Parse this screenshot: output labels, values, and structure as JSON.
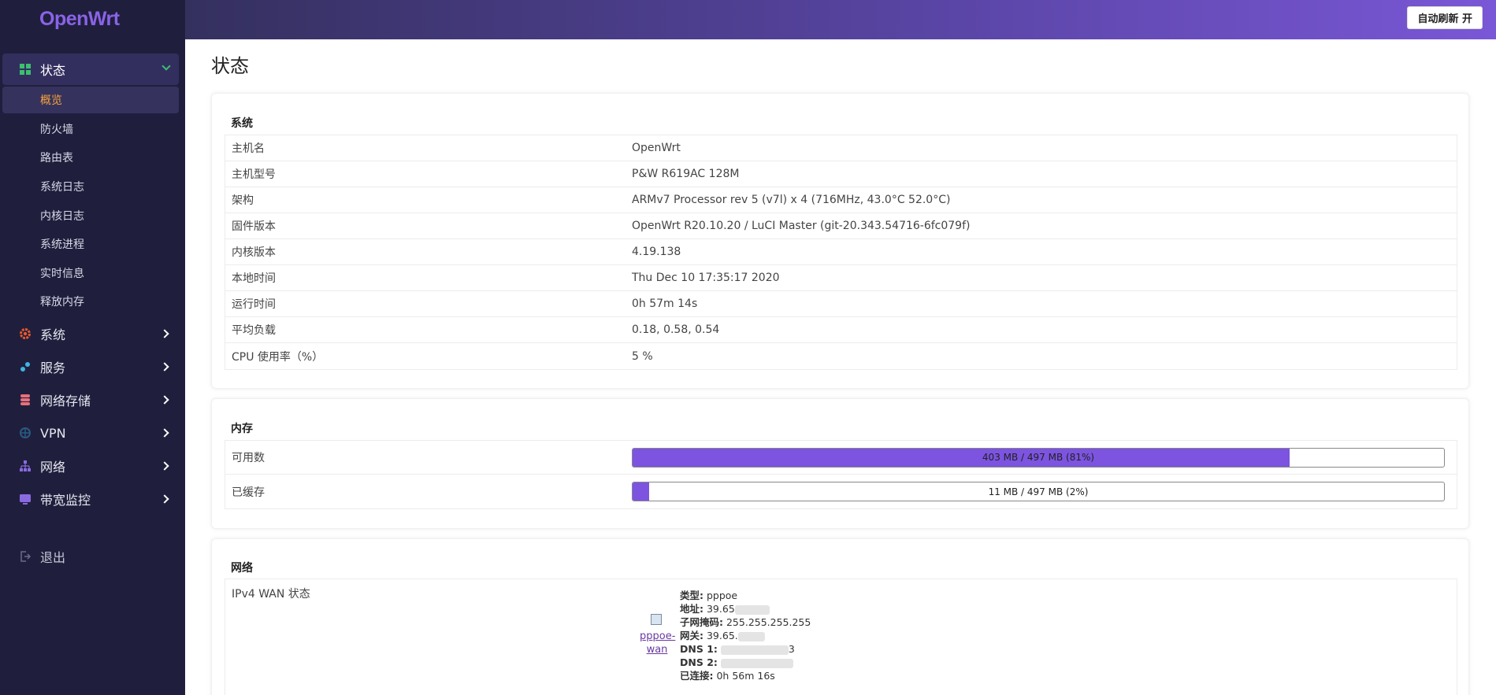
{
  "app": {
    "logo": "OpenWrt"
  },
  "header": {
    "auto_refresh_label": "自动刷新 开"
  },
  "sidebar": {
    "status_label": "状态",
    "sub_items": [
      "概览",
      "防火墙",
      "路由表",
      "系统日志",
      "内核日志",
      "系统进程",
      "实时信息",
      "释放内存"
    ],
    "items": [
      {
        "label": "系统",
        "icon": "gear-icon",
        "color": "#e8582a"
      },
      {
        "label": "服务",
        "icon": "services-icon",
        "color": "#3fb6e0"
      },
      {
        "label": "网络存储",
        "icon": "database-icon",
        "color": "#e8707a"
      },
      {
        "label": "VPN",
        "icon": "vpn-icon",
        "color": "#2a5a80"
      },
      {
        "label": "网络",
        "icon": "network-icon",
        "color": "#8a6ae0"
      },
      {
        "label": "带宽监控",
        "icon": "monitor-icon",
        "color": "#8a6ae0"
      }
    ],
    "logout_label": "退出"
  },
  "page": {
    "title": "状态"
  },
  "system": {
    "heading": "系统",
    "rows": [
      {
        "k": "主机名",
        "v": "OpenWrt"
      },
      {
        "k": "主机型号",
        "v": "P&W R619AC 128M"
      },
      {
        "k": "架构",
        "v": "ARMv7 Processor rev 5 (v7l) x 4 (716MHz, 43.0°C 52.0°C)"
      },
      {
        "k": "固件版本",
        "v": "OpenWrt R20.10.20 / LuCI Master (git-20.343.54716-6fc079f)"
      },
      {
        "k": "内核版本",
        "v": "4.19.138"
      },
      {
        "k": "本地时间",
        "v": "Thu Dec 10 17:35:17 2020"
      },
      {
        "k": "运行时间",
        "v": "0h 57m 14s"
      },
      {
        "k": "平均负载",
        "v": "0.18, 0.58, 0.54"
      },
      {
        "k": "CPU 使用率（%）",
        "v": "5 %"
      }
    ]
  },
  "memory": {
    "heading": "内存",
    "rows": [
      {
        "k": "可用数",
        "text": "403 MB / 497 MB (81%)",
        "fraction": 0.81
      },
      {
        "k": "已缓存",
        "text": "11 MB / 497 MB (2%)",
        "fraction": 0.02
      }
    ]
  },
  "network": {
    "heading": "网络",
    "wan_label": "IPv4 WAN 状态",
    "iface_link": "pppoe-wan",
    "type_label": "类型:",
    "type_value": "pppoe",
    "addr_label": "地址:",
    "addr_value": "39.65",
    "mask_label": "子网掩码:",
    "mask_value": "255.255.255.255",
    "gw_label": "网关:",
    "gw_value": "39.65.",
    "dns1_label": "DNS 1:",
    "dns1_value": "3",
    "dns2_label": "DNS 2:",
    "dns2_value": "",
    "connected_label": "已连接:",
    "connected_value": "0h 56m 16s"
  }
}
